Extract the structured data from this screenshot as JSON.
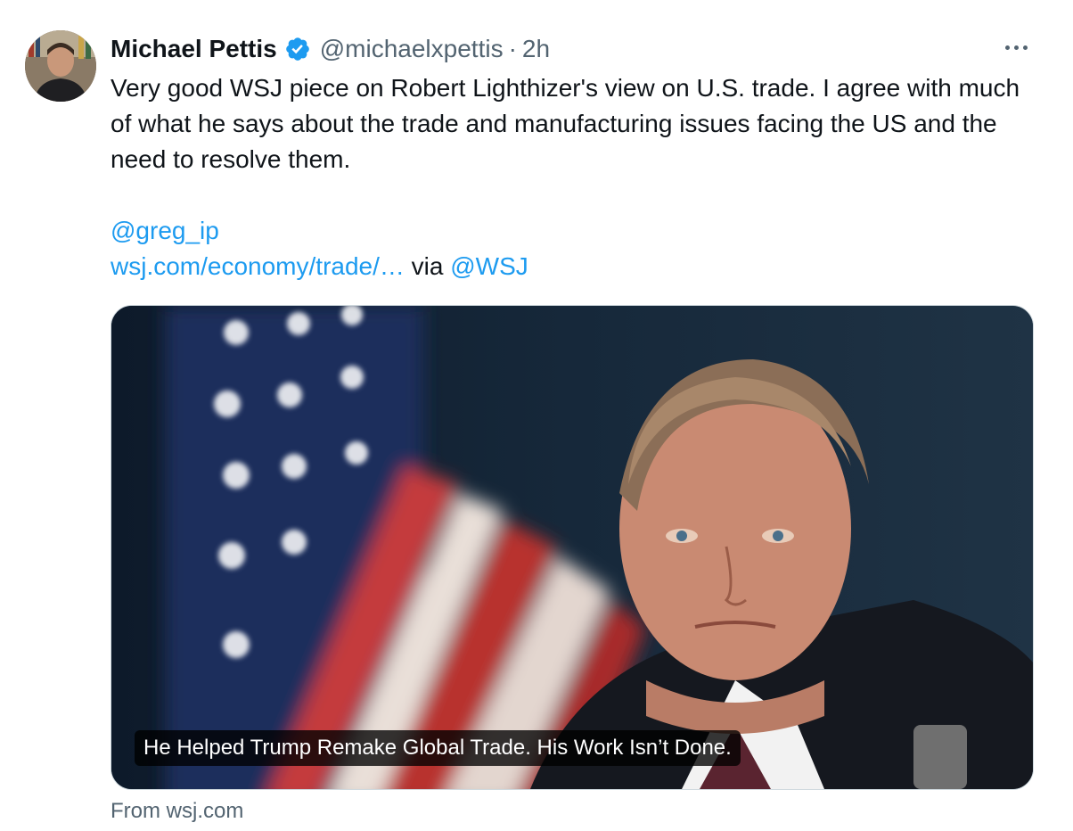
{
  "author": {
    "name": "Michael Pettis",
    "handle": "@michaelxpettis",
    "separator": "·",
    "time": "2h"
  },
  "icons": {
    "verified": "verified-badge-icon",
    "more": "more-horizontal-icon",
    "verified_color": "#1d9bf0"
  },
  "tweet": {
    "text": "Very good WSJ piece on Robert Lighthizer's view on U.S. trade. I agree with much of what he says about the trade and manufacturing issues facing the US and the need to resolve them.",
    "mention": "@greg_ip",
    "link": "wsj.com/economy/trade/…",
    "via": " via ",
    "via_mention": "@WSJ"
  },
  "card": {
    "caption": "He Helped Trump Remake Global Trade. His Work Isn’t Done.",
    "source": "From wsj.com"
  },
  "colors": {
    "link": "#1d9bf0",
    "secondary_text": "#536471",
    "primary_text": "#0f1419"
  }
}
